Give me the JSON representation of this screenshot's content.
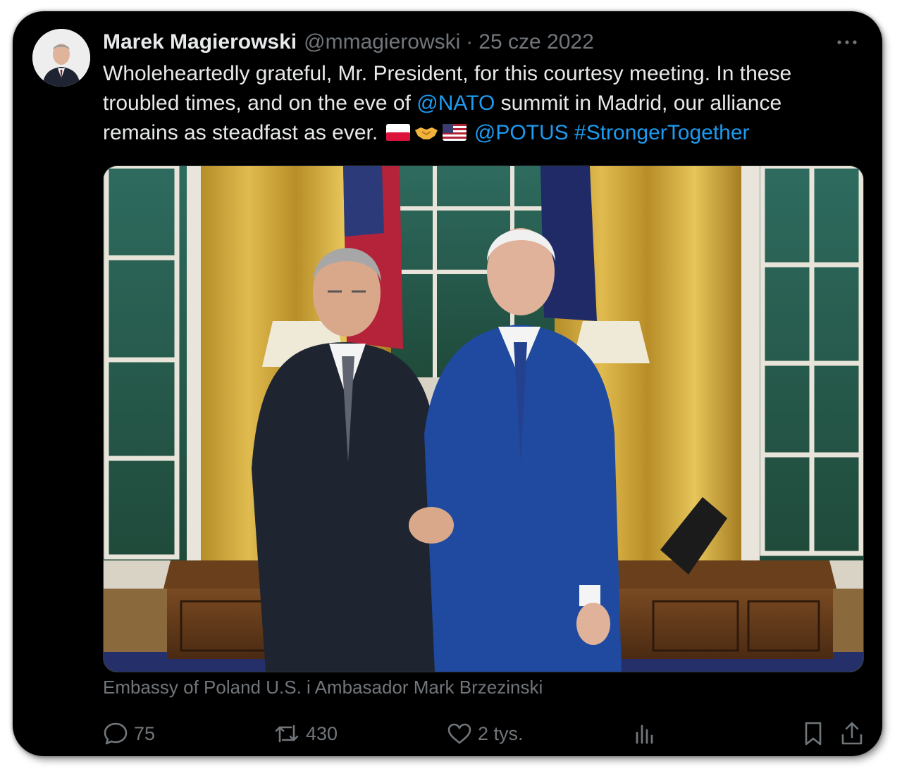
{
  "tweet": {
    "author_name": "Marek Magierowski",
    "handle": "@mmagierowski",
    "separator": "·",
    "date": "25 cze 2022",
    "text_part1": "Wholeheartedly grateful, Mr. President, for this courtesy meeting. In these troubled times, and on the eve of ",
    "mention_nato": "@NATO",
    "text_part2": " summit in Madrid, our alliance remains as steadfast as ever. ",
    "mention_potus": "@POTUS",
    "hashtag": "#StrongerTogether",
    "emojis": [
      "flag-poland-icon",
      "handshake-icon",
      "flag-usa-icon"
    ],
    "media_caption": "Embassy of Poland U.S. i Ambasador Mark Brzezinski"
  },
  "actions": {
    "replies": "75",
    "reposts": "430",
    "likes": "2 tys."
  },
  "colors": {
    "background": "#000000",
    "text": "#e7e9ea",
    "muted": "#71767b",
    "link": "#1d9bf0"
  }
}
